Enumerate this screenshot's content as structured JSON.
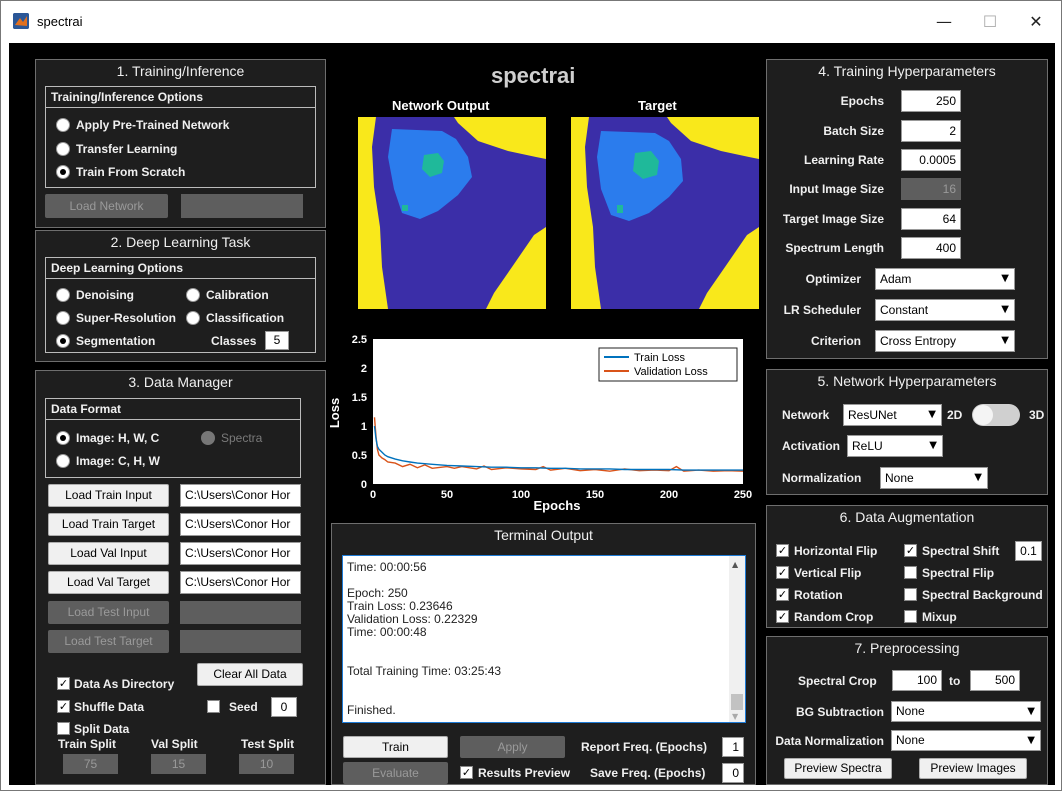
{
  "window": {
    "title": "spectrai",
    "minimize": "—",
    "maximize": "☐",
    "close": "✕"
  },
  "app_title": "spectrai",
  "training_inference": {
    "title": "1. Training/Inference",
    "group_title": "Training/Inference Options",
    "options": [
      {
        "label": "Apply Pre-Trained Network",
        "selected": false
      },
      {
        "label": "Transfer Learning",
        "selected": false
      },
      {
        "label": "Train From Scratch",
        "selected": true
      }
    ],
    "load_network": "Load Network",
    "network_path": ""
  },
  "deep_learning_task": {
    "title": "2. Deep Learning Task",
    "group_title": "Deep Learning Options",
    "denoising": "Denoising",
    "calibration": "Calibration",
    "super_resolution": "Super-Resolution",
    "classification": "Classification",
    "segmentation": "Segmentation",
    "classes_label": "Classes",
    "classes_value": "5"
  },
  "data_manager": {
    "title": "3. Data Manager",
    "group_title": "Data Format",
    "format_hwc": "Image: H, W, C",
    "format_spectra": "Spectra",
    "format_chw": "Image: C, H, W",
    "load_train_input": "Load Train Input",
    "load_train_target": "Load Train Target",
    "load_val_input": "Load Val Input",
    "load_val_target": "Load Val Target",
    "load_test_input": "Load Test Input",
    "load_test_target": "Load Test Target",
    "train_input_path": "C:\\Users\\Conor Hor",
    "train_target_path": "C:\\Users\\Conor Hor",
    "val_input_path": "C:\\Users\\Conor Hor",
    "val_target_path": "C:\\Users\\Conor Hor",
    "test_input_path": "",
    "test_target_path": "",
    "data_as_directory": "Data As Directory",
    "clear_all": "Clear All Data",
    "shuffle_data": "Shuffle Data",
    "seed_label": "Seed",
    "seed_value": "0",
    "split_data": "Split Data",
    "train_split_label": "Train Split",
    "val_split_label": "Val Split",
    "test_split_label": "Test Split",
    "train_split": "75",
    "val_split": "15",
    "test_split": "10"
  },
  "images": {
    "network_output_title": "Network Output",
    "target_title": "Target"
  },
  "chart_data": {
    "type": "line",
    "xlabel": "Epochs",
    "ylabel": "Loss",
    "xlim": [
      0,
      250
    ],
    "ylim": [
      0,
      2.5
    ],
    "xticks": [
      "0",
      "50",
      "100",
      "150",
      "200",
      "250"
    ],
    "yticks": [
      "0",
      "0.5",
      "1",
      "1.5",
      "2",
      "2.5"
    ],
    "grid": false,
    "legend_position": "top-right",
    "series": [
      {
        "name": "Train Loss",
        "color": "#0072bd",
        "x": [
          1,
          2,
          3,
          4,
          6,
          8,
          10,
          15,
          20,
          25,
          30,
          40,
          50,
          60,
          70,
          80,
          90,
          100,
          110,
          120,
          130,
          140,
          150,
          160,
          170,
          180,
          190,
          200,
          210,
          220,
          230,
          240,
          250
        ],
        "y": [
          1.0,
          0.78,
          0.65,
          0.6,
          0.55,
          0.5,
          0.47,
          0.43,
          0.4,
          0.38,
          0.36,
          0.34,
          0.32,
          0.31,
          0.3,
          0.29,
          0.29,
          0.28,
          0.28,
          0.27,
          0.27,
          0.26,
          0.26,
          0.26,
          0.25,
          0.25,
          0.25,
          0.25,
          0.24,
          0.24,
          0.24,
          0.24,
          0.24
        ]
      },
      {
        "name": "Validation Loss",
        "color": "#d95319",
        "x": [
          1,
          2,
          3,
          4,
          6,
          8,
          10,
          15,
          20,
          25,
          30,
          35,
          40,
          50,
          55,
          60,
          70,
          75,
          80,
          90,
          100,
          110,
          115,
          120,
          130,
          140,
          150,
          160,
          170,
          180,
          190,
          200,
          205,
          210,
          220,
          230,
          240,
          250
        ],
        "y": [
          1.15,
          0.82,
          0.6,
          0.5,
          0.45,
          0.42,
          0.38,
          0.36,
          0.3,
          0.34,
          0.28,
          0.33,
          0.27,
          0.3,
          0.27,
          0.3,
          0.26,
          0.31,
          0.25,
          0.28,
          0.26,
          0.25,
          0.3,
          0.24,
          0.27,
          0.23,
          0.25,
          0.22,
          0.26,
          0.23,
          0.24,
          0.23,
          0.3,
          0.22,
          0.24,
          0.22,
          0.23,
          0.22
        ]
      }
    ]
  },
  "terminal": {
    "title": "Terminal Output",
    "text": "Time: 00:00:56\n\nEpoch: 250\nTrain Loss: 0.23646\nValidation Loss: 0.22329\nTime: 00:00:48\n\n\nTotal Training Time: 03:25:43\n\n\nFinished."
  },
  "controls": {
    "train": "Train",
    "apply": "Apply",
    "evaluate": "Evaluate",
    "results_preview": "Results Preview",
    "report_freq_label": "Report Freq. (Epochs)",
    "report_freq": "1",
    "save_freq_label": "Save Freq. (Epochs)",
    "save_freq": "0"
  },
  "training_hyperparameters": {
    "title": "4. Training Hyperparameters",
    "epochs_label": "Epochs",
    "epochs": "250",
    "batch_size_label": "Batch Size",
    "batch_size": "2",
    "learning_rate_label": "Learning Rate",
    "learning_rate": "0.0005",
    "input_image_size_label": "Input Image Size",
    "input_image_size": "16",
    "target_image_size_label": "Target Image Size",
    "target_image_size": "64",
    "spectrum_length_label": "Spectrum Length",
    "spectrum_length": "400",
    "optimizer_label": "Optimizer",
    "optimizer": "Adam",
    "lr_scheduler_label": "LR Scheduler",
    "lr_scheduler": "Constant",
    "criterion_label": "Criterion",
    "criterion": "Cross Entropy"
  },
  "network_hyperparameters": {
    "title": "5. Network Hyperparameters",
    "network_label": "Network",
    "network": "ResUNet",
    "dim_2d": "2D",
    "dim_3d": "3D",
    "activation_label": "Activation",
    "activation": "ReLU",
    "normalization_label": "Normalization",
    "normalization": "None"
  },
  "data_augmentation": {
    "title": "6. Data Augmentation",
    "horizontal_flip": "Horizontal Flip",
    "spectral_shift": "Spectral Shift",
    "spectral_shift_value": "0.1",
    "vertical_flip": "Vertical Flip",
    "spectral_flip": "Spectral Flip",
    "rotation": "Rotation",
    "spectral_background": "Spectral Background",
    "random_crop": "Random Crop",
    "mixup": "Mixup"
  },
  "preprocessing": {
    "title": "7. Preprocessing",
    "spectral_crop_label": "Spectral Crop",
    "crop_start": "100",
    "to_label": "to",
    "crop_end": "500",
    "bg_subtraction_label": "BG Subtraction",
    "bg_subtraction": "None",
    "data_normalization_label": "Data Normalization",
    "data_normalization": "None",
    "preview_spectra": "Preview Spectra",
    "preview_images": "Preview Images"
  },
  "colors": {
    "yellow": "#f9e81b",
    "blue_dark": "#3b2ea8",
    "blue_mid": "#2b7ced",
    "teal": "#1fb99a",
    "background": "#000000"
  }
}
